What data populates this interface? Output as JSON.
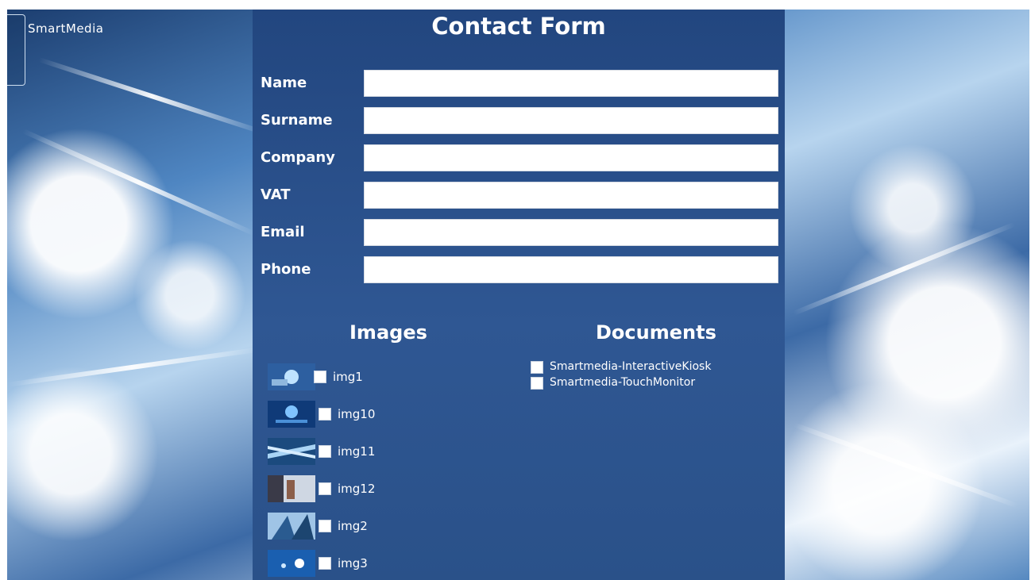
{
  "brand": {
    "logo_text": "SmartMedia"
  },
  "form": {
    "title": "Contact Form",
    "fields": [
      {
        "label": "Name",
        "value": "",
        "placeholder": ""
      },
      {
        "label": "Surname",
        "value": "",
        "placeholder": ""
      },
      {
        "label": "Company",
        "value": "",
        "placeholder": ""
      },
      {
        "label": "VAT",
        "value": "",
        "placeholder": ""
      },
      {
        "label": "Email",
        "value": "",
        "placeholder": ""
      },
      {
        "label": "Phone",
        "value": "",
        "placeholder": ""
      }
    ]
  },
  "images": {
    "heading": "Images",
    "items": [
      {
        "label": "img1",
        "checked": false
      },
      {
        "label": "img10",
        "checked": false
      },
      {
        "label": "img11",
        "checked": false
      },
      {
        "label": "img12",
        "checked": false
      },
      {
        "label": "img2",
        "checked": false
      },
      {
        "label": "img3",
        "checked": false
      }
    ]
  },
  "documents": {
    "heading": "Documents",
    "items": [
      {
        "label": "Smartmedia-InteractiveKiosk",
        "checked": false
      },
      {
        "label": "Smartmedia-TouchMonitor",
        "checked": false
      }
    ]
  },
  "colors": {
    "panel": "#2a5189",
    "background_accent": "#4f86c2",
    "input_bg": "#ffffff"
  }
}
